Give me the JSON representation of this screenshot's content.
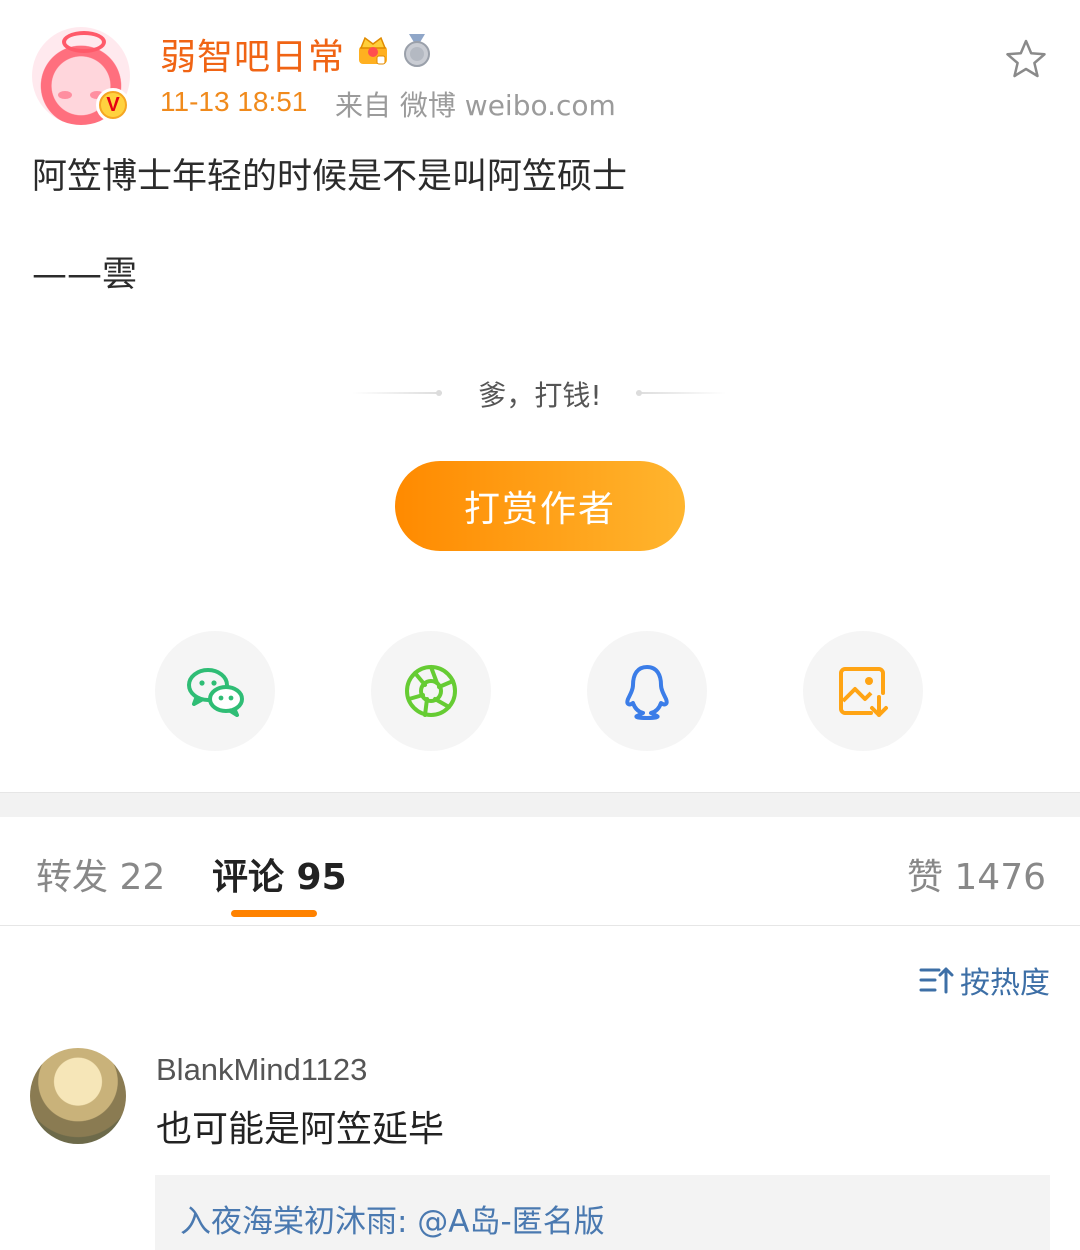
{
  "header": {
    "username": "弱智吧日常",
    "timestamp": "11-13 18:51",
    "source": "来自 微博 weibo.com",
    "verified_mark": "V"
  },
  "post": {
    "text": "阿笠博士年轻的时候是不是叫阿笠硕士",
    "signature": "——雲"
  },
  "reward": {
    "hint": "爹，打钱!",
    "button_label": "打赏作者"
  },
  "share": {
    "items": [
      "wechat-icon",
      "moments-icon",
      "qq-icon",
      "save-image-icon"
    ],
    "colors": {
      "wechat": "#2fbd75",
      "moments": "#66cc33",
      "qq": "#3b7de8",
      "save": "#ffa414"
    }
  },
  "tabs": {
    "repost": "转发 22",
    "comment": "评论 95",
    "like": "赞 1476"
  },
  "sort": {
    "label": "按热度"
  },
  "comments": [
    {
      "username": "BlankMind1123",
      "text": "也可能是阿笠延毕",
      "reply": "入夜海棠初沐雨: @A岛-匿名版"
    }
  ],
  "colors": {
    "accent": "#ff8200",
    "username": "#f06414",
    "link": "#4a79b0"
  }
}
